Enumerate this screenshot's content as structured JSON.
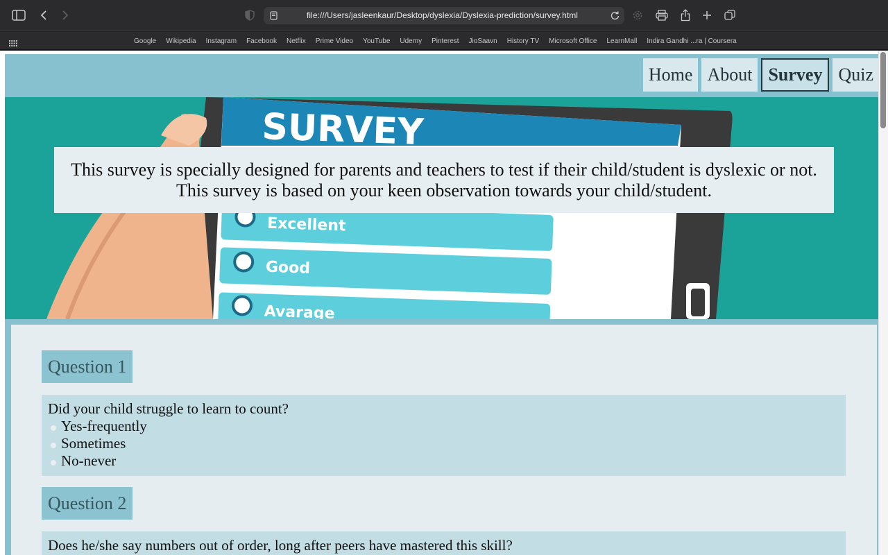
{
  "browser": {
    "url": "file:///Users/jasleenkaur/Desktop/dyslexia/Dyslexia-prediction/survey.html",
    "bookmarks": [
      "Google",
      "Wikipedia",
      "Instagram",
      "Facebook",
      "Netflix",
      "Prime Video",
      "YouTube",
      "Udemy",
      "Pinterest",
      "JioSaavn",
      "History TV",
      "Microsoft Office",
      "LearnMall",
      "Indira Gandhi ...ra | Coursera"
    ]
  },
  "nav": {
    "home": "Home",
    "about": "About",
    "survey": "Survey",
    "quiz": "Quiz",
    "active": "Survey"
  },
  "hero": {
    "image_sign": "SURVEY",
    "image_options": [
      "Excellent",
      "Good",
      "Avarage"
    ],
    "caption": "This survey is specially designed for parents and teachers to test if their child/student is dyslexic or not. This survey is based on your keen observation towards your child/student."
  },
  "questions": [
    {
      "title": "Question 1",
      "text": "Did your child struggle to learn to count?",
      "options": [
        "Yes-frequently",
        "Sometimes",
        "No-never"
      ]
    },
    {
      "title": "Question 2",
      "text": "Does he/she say numbers out of order, long after peers have mastered this skill?"
    }
  ],
  "colors": {
    "site_bg": "#87c0cf",
    "hero_bg": "#1ba39a",
    "question_title_bg": "#8cc3d1",
    "question_box_bg": "#c2dde3"
  }
}
